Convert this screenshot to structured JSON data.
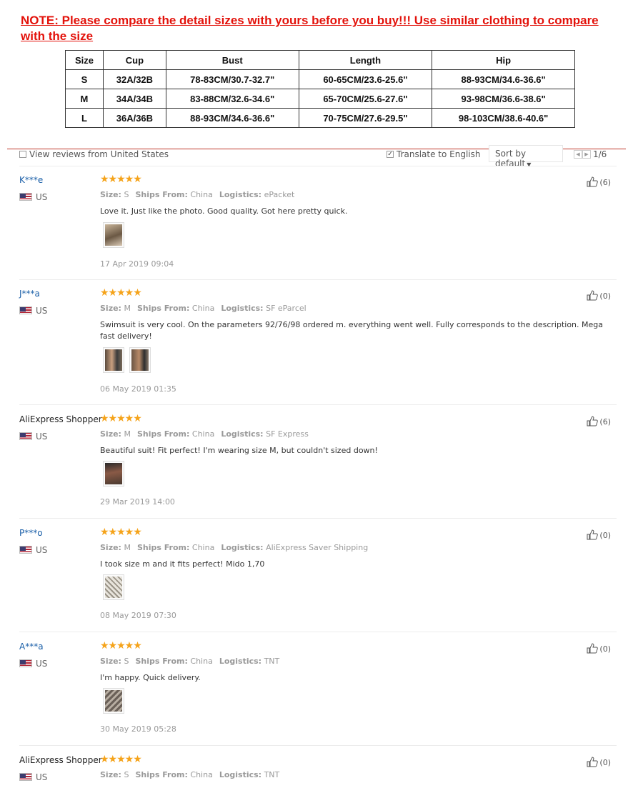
{
  "note": "NOTE: Please compare the detail sizes with yours before you buy!!! Use similar clothing to compare with the size",
  "size_table": {
    "headers": [
      "Size",
      "Cup",
      "Bust",
      "Length",
      "Hip"
    ],
    "rows": [
      [
        "S",
        "32A/32B",
        "78-83CM/30.7-32.7\"",
        "60-65CM/23.6-25.6\"",
        "88-93CM/34.6-36.6\""
      ],
      [
        "M",
        "34A/34B",
        "83-88CM/32.6-34.6\"",
        "65-70CM/25.6-27.6\"",
        "93-98CM/36.6-38.6\""
      ],
      [
        "L",
        "36A/36B",
        "88-93CM/34.6-36.6\"",
        "70-75CM/27.6-29.5\"",
        "98-103CM/38.6-40.6\""
      ]
    ]
  },
  "toolbar": {
    "view_reviews_label": "View reviews from United States",
    "translate_label": "Translate to English",
    "translate_checked": true,
    "sort_label": "Sort by default",
    "page": "1/6"
  },
  "labels": {
    "size": "Size:",
    "ships_from": "Ships From:",
    "logistics": "Logistics:"
  },
  "reviews": [
    {
      "user": "K***e",
      "country": "US",
      "stars": "★★★★★",
      "size": "S",
      "ships_from": "China",
      "logistics": "ePacket",
      "text": "Love it. Just like the photo. Good quality. Got here pretty quick.",
      "date": "17 Apr 2019 09:04",
      "likes": "(6)"
    },
    {
      "user": "J***a",
      "country": "US",
      "stars": "★★★★★",
      "size": "M",
      "ships_from": "China",
      "logistics": "SF eParcel",
      "text": "Swimsuit is very cool. On the parameters 92/76/98 ordered m. everything went well. Fully corresponds to the description. Mega fast delivery!",
      "date": "06 May 2019 01:35",
      "likes": "(0)"
    },
    {
      "user": "AliExpress Shopper",
      "country": "US",
      "stars": "★★★★★",
      "size": "M",
      "ships_from": "China",
      "logistics": "SF Express",
      "text": "Beautiful suit! Fit perfect! I'm wearing size M, but couldn't sized down!",
      "date": "29 Mar 2019 14:00",
      "likes": "(6)"
    },
    {
      "user": "P***o",
      "country": "US",
      "stars": "★★★★★",
      "size": "M",
      "ships_from": "China",
      "logistics": "AliExpress Saver Shipping",
      "text": "I took size m and it fits perfect! Mido 1,70",
      "date": "08 May 2019 07:30",
      "likes": "(0)"
    },
    {
      "user": "A***a",
      "country": "US",
      "stars": "★★★★★",
      "size": "S",
      "ships_from": "China",
      "logistics": "TNT",
      "text": "I'm happy. Quick delivery.",
      "date": "30 May 2019 05:28",
      "likes": "(0)"
    },
    {
      "user": "AliExpress Shopper",
      "country": "US",
      "stars": "★★★★★",
      "size": "S",
      "ships_from": "China",
      "logistics": "TNT",
      "likes": "(0)"
    }
  ],
  "colors": {
    "note_red": "#e3120b",
    "link_blue": "#1a5fa8",
    "star": "#f5a31a"
  }
}
